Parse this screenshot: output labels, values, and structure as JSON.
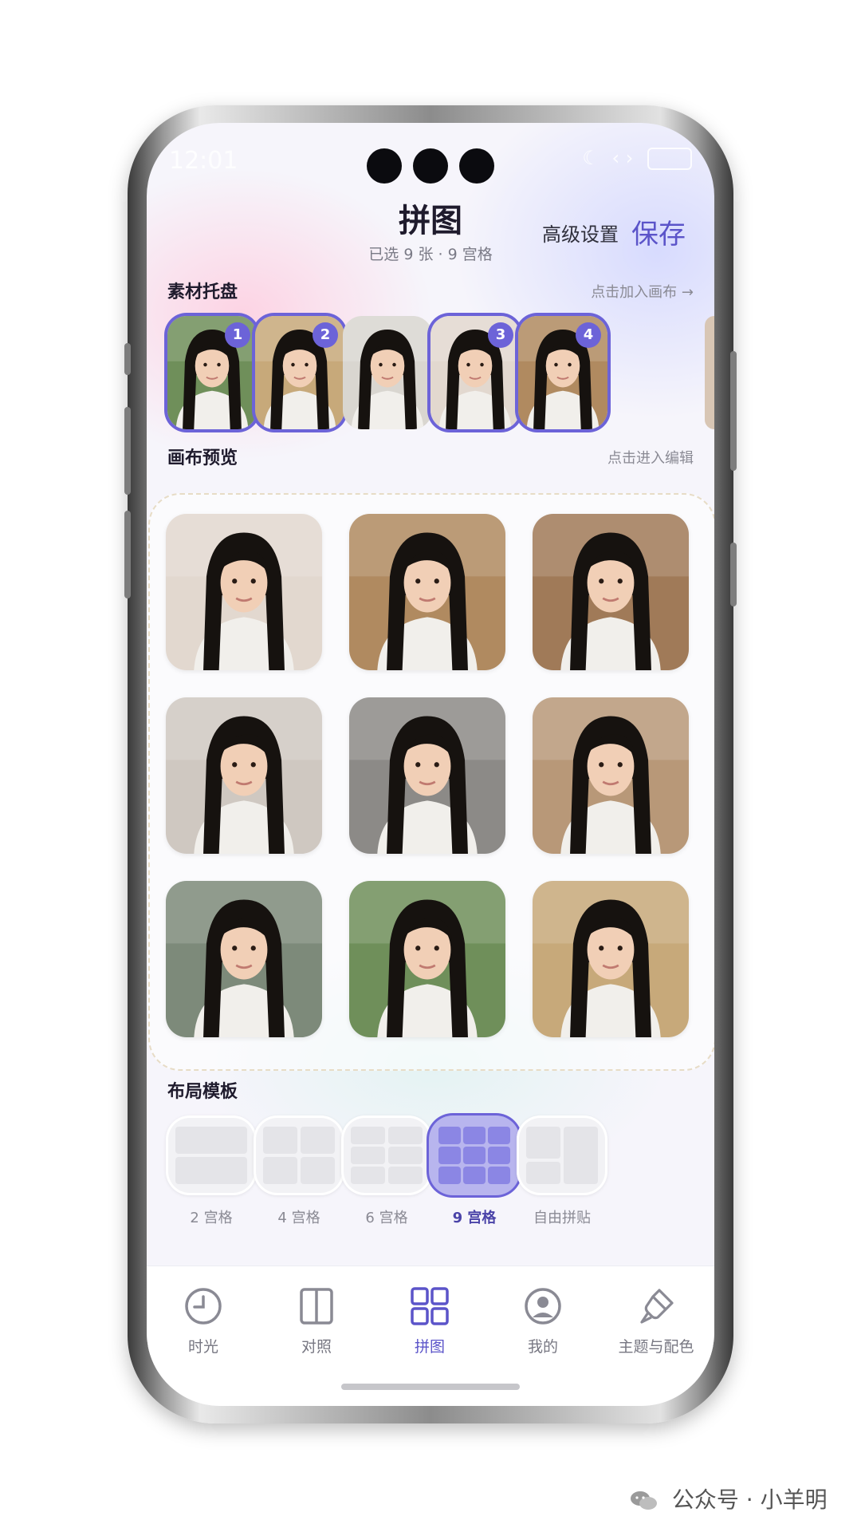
{
  "status": {
    "time": "12:01"
  },
  "header": {
    "title": "拼图",
    "subtitle": "已选 9 张 · 9 宫格",
    "advanced_label": "高级设置",
    "save_label": "保存"
  },
  "tray": {
    "label": "素材托盘",
    "hint": "点击加入画布 →",
    "items": [
      {
        "badge": "1",
        "selected": true
      },
      {
        "badge": "2",
        "selected": true
      },
      {
        "badge": "",
        "selected": false
      },
      {
        "badge": "3",
        "selected": true
      },
      {
        "badge": "4",
        "selected": true
      }
    ]
  },
  "canvas": {
    "label": "画布预览",
    "hint": "点击进入编辑",
    "cells": 9
  },
  "templates": {
    "label": "布局模板",
    "items": [
      {
        "label": "2 宫格",
        "active": false
      },
      {
        "label": "4 宫格",
        "active": false
      },
      {
        "label": "6 宫格",
        "active": false
      },
      {
        "label": "9 宫格",
        "active": true
      },
      {
        "label": "自由拼贴",
        "active": false
      }
    ]
  },
  "nav": {
    "items": [
      {
        "label": "时光",
        "icon": "clock-icon",
        "active": false
      },
      {
        "label": "对照",
        "icon": "split-view-icon",
        "active": false
      },
      {
        "label": "拼图",
        "icon": "grid-icon",
        "active": true
      },
      {
        "label": "我的",
        "icon": "user-icon",
        "active": false
      },
      {
        "label": "主题与配色",
        "icon": "paint-brush-icon",
        "active": false
      }
    ]
  },
  "watermark": {
    "text": "公众号 · 小羊明"
  },
  "colors": {
    "accent": "#6c63d8",
    "accent_text": "#5b54c9"
  }
}
